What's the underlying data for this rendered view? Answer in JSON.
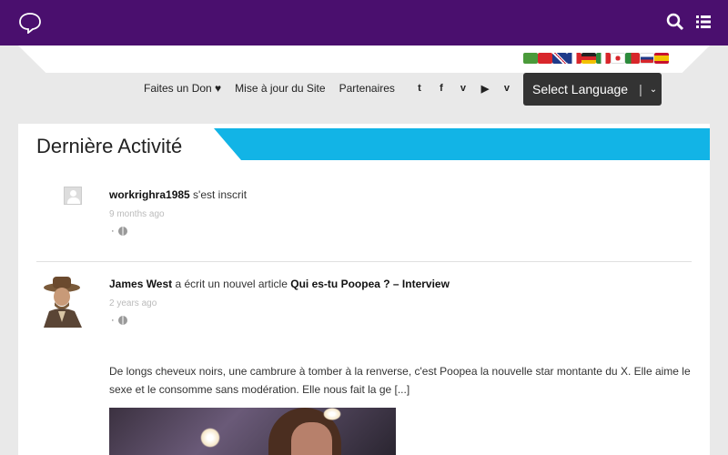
{
  "topbar": {
    "bg": "#4a0f6e",
    "logo_icon": "chat-bubble-icon",
    "icons": [
      "search-icon",
      "menu-icon"
    ]
  },
  "language": {
    "flags": [
      "arabic",
      "chinese",
      "english",
      "french",
      "german",
      "italian",
      "japanese",
      "portuguese",
      "russian",
      "spanish"
    ],
    "select_label": "Select Language"
  },
  "nav": {
    "links": [
      "Faites un Don ♥",
      "Mise à jour du Site",
      "Partenaires"
    ],
    "social": [
      "twitter-icon",
      "facebook-icon",
      "vimeo-icon",
      "youtube-icon",
      "vine-icon"
    ],
    "social_glyphs": [
      "t",
      "f",
      "v",
      "▶",
      "v"
    ]
  },
  "section": {
    "title": "Dernière Activité",
    "accent": "#12b4e6"
  },
  "activities": [
    {
      "user": "workrighra1985",
      "action": " s'est inscrit",
      "time": "9 months ago",
      "meta": "·"
    },
    {
      "user": "James West",
      "action": " a écrit un nouvel article ",
      "article": "Qui es-tu Poopea ? – Interview",
      "time": "2 years ago",
      "meta": "·",
      "excerpt": "De longs cheveux noirs, une cambrure à tomber à la renverse, c'est Poopea la nouvelle star montante du X. Elle aime le sexe et le consomme sans modération. Elle nous fait la ge [...]"
    }
  ]
}
